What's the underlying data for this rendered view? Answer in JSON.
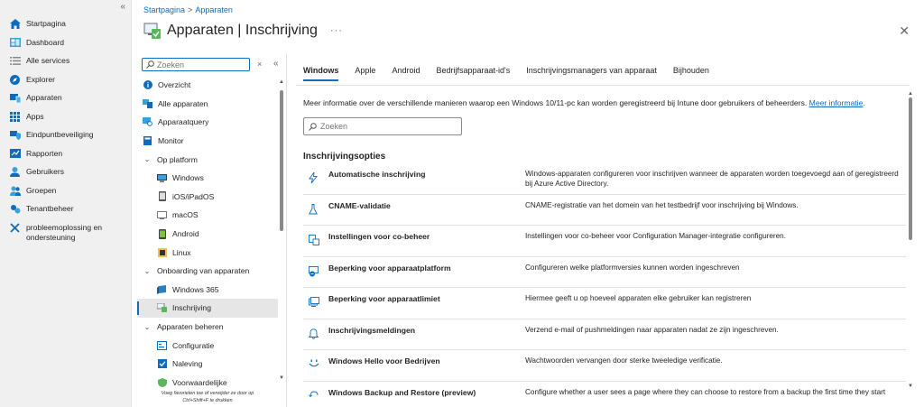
{
  "global_nav": {
    "items": [
      {
        "label": "Startpagina",
        "icon": "home-icon"
      },
      {
        "label": "Dashboard",
        "icon": "dashboard-icon"
      },
      {
        "label": "Alle services",
        "icon": "list-icon"
      },
      {
        "label": "Explorer",
        "icon": "explorer-icon"
      },
      {
        "label": "Apparaten",
        "icon": "devices-icon"
      },
      {
        "label": "Apps",
        "icon": "apps-grid-icon"
      },
      {
        "label": "Eindpuntbeveiliging",
        "icon": "shield-icon"
      },
      {
        "label": "Rapporten",
        "icon": "reports-icon"
      },
      {
        "label": "Gebruikers",
        "icon": "user-icon"
      },
      {
        "label": "Groepen",
        "icon": "groups-icon"
      },
      {
        "label": "Tenantbeheer",
        "icon": "tenant-icon"
      },
      {
        "label": "probleemoplossing en ondersteuning",
        "icon": "tools-icon"
      }
    ]
  },
  "breadcrumb": {
    "home": "Startpagina",
    "sep": ">",
    "current": "Apparaten"
  },
  "header": {
    "title": "Apparaten | Inschrijving",
    "more": "···"
  },
  "sec_nav": {
    "search_placeholder": "Zoeken",
    "clear": "×",
    "collapse": "«",
    "items": [
      {
        "label": "Overzicht",
        "kind": "top"
      },
      {
        "label": "Alle apparaten",
        "kind": "top"
      },
      {
        "label": "Apparaatquery",
        "kind": "top"
      },
      {
        "label": "Monitor",
        "kind": "top"
      },
      {
        "label": "Op platform",
        "kind": "group"
      },
      {
        "label": "Windows",
        "kind": "sub"
      },
      {
        "label": "iOS/iPadOS",
        "kind": "sub"
      },
      {
        "label": "macOS",
        "kind": "sub"
      },
      {
        "label": "Android",
        "kind": "sub"
      },
      {
        "label": "Linux",
        "kind": "sub"
      },
      {
        "label": "Onboarding van apparaten",
        "kind": "group"
      },
      {
        "label": "Windows 365",
        "kind": "sub"
      },
      {
        "label": "Inschrijving",
        "kind": "sub",
        "active": true
      },
      {
        "label": "Apparaten beheren",
        "kind": "group"
      },
      {
        "label": "Configuratie",
        "kind": "sub"
      },
      {
        "label": "Naleving",
        "kind": "sub"
      },
      {
        "label": "Voorwaardelijke",
        "kind": "sub"
      }
    ],
    "hint_line1": "Voeg favorieten toe of verwijder ze door op",
    "hint_line2": "Ctrl+Shift+F te drukken"
  },
  "tabs": [
    "Windows",
    "Apple",
    "Android",
    "Bedrijfsapparaat-id's",
    "Inschrijvingsmanagers van apparaat",
    "Bijhouden"
  ],
  "info": {
    "text": "Meer informatie over de verschillende manieren waarop een Windows 10/11-pc kan worden geregistreerd bij Intune door gebruikers of beheerders.",
    "link": "Meer informatie",
    "end": "."
  },
  "search": {
    "placeholder": "Zoeken"
  },
  "section_title": "Inschrijvingsopties",
  "options": [
    {
      "name": "Automatische inschrijving",
      "desc": "Windows-apparaten configureren voor inschrijven wanneer de apparaten worden toegevoegd aan of geregistreerd bij Azure Active Directory.",
      "icon": "lightning-icon"
    },
    {
      "name": "CNAME-validatie",
      "desc": "CNAME-registratie van het domein van het testbedrijf voor inschrijving bij Windows.",
      "icon": "flask-icon"
    },
    {
      "name": "Instellingen voor co-beheer",
      "desc": "Instellingen voor co-beheer voor Configuration Manager-integratie configureren.",
      "icon": "co-management-icon"
    },
    {
      "name": "Beperking voor apparaatplatform",
      "desc": "Configureren welke platformversies kunnen worden ingeschreven",
      "icon": "platform-restriction-icon"
    },
    {
      "name": "Beperking voor apparaatlimiet",
      "desc": "Hiermee geeft u op hoeveel apparaten elke gebruiker kan registreren",
      "icon": "device-limit-icon"
    },
    {
      "name": "Inschrijvingsmeldingen",
      "desc": "Verzend e-mail of pushmeldingen naar apparaten nadat ze zijn ingeschreven.",
      "icon": "bell-icon"
    },
    {
      "name": "Windows Hello voor Bedrijven",
      "desc": "Wachtwoorden vervangen door sterke tweeledige verificatie.",
      "icon": "smile-icon"
    },
    {
      "name": "Windows Backup and Restore (preview)",
      "desc": "Configure whether a user sees a page where they can choose to restore from a backup the first time they start",
      "icon": "restore-icon"
    }
  ],
  "colors": {
    "accent": "#0f6cbd",
    "nav_bg": "#f0f0f0"
  }
}
